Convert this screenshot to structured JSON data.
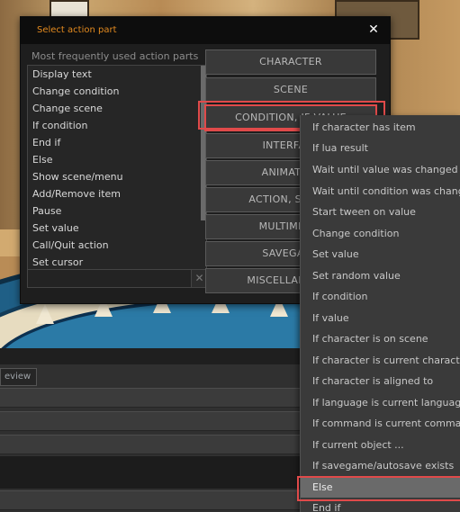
{
  "dialog": {
    "title": "Select action part",
    "subtitle": "Most frequently used action parts",
    "close_icon": "close-icon",
    "frequent_items": [
      "Display text",
      "Change condition",
      "Change scene",
      "If condition",
      "End if",
      "Else",
      "Show scene/menu",
      "Add/Remove item",
      "Pause",
      "Set value",
      "Call/Quit action",
      "Set cursor"
    ],
    "search": {
      "value": "",
      "clear_glyph": "✕"
    },
    "categories": [
      "CHARACTER",
      "SCENE",
      "CONDITION, IF VALUE",
      "INTERFACE",
      "ANIMATION",
      "ACTION, SOUND",
      "MULTIMEDIA",
      "SAVEGAME",
      "MISCELLANEOUS"
    ]
  },
  "submenu": {
    "items": [
      "If character has item",
      "If lua result",
      "Wait until value was changed",
      "Wait until condition was changed",
      "Start tween on value",
      "Change condition",
      "Set value",
      "Set random value",
      "If condition",
      "If value",
      "If character is on scene",
      "If character is current character",
      "If character is aligned to",
      "If language is current language",
      "If command is current command",
      "If current object ...",
      "If savegame/autosave exists",
      "Else",
      "End if"
    ],
    "selected": "Else"
  },
  "editor": {
    "preview_tab": "eview"
  },
  "colors": {
    "accent": "#e38a1f",
    "highlight_outline": "#e04a4a",
    "selected_bg": "#6a6a6a"
  }
}
